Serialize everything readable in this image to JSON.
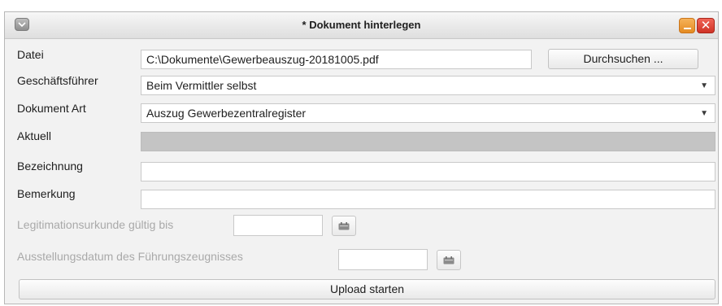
{
  "window": {
    "title": "* Dokument hinterlegen",
    "close_glyph": "✕"
  },
  "form": {
    "datei": {
      "label": "Datei",
      "value": "C:\\Dokumente\\Gewerbeauszug-20181005.pdf",
      "browse_label": "Durchsuchen ..."
    },
    "geschaeftsfuehrer": {
      "label": "Geschäftsführer",
      "value": "Beim Vermittler selbst"
    },
    "dokument_art": {
      "label": "Dokument Art",
      "value": "Auszug Gewerbezentralregister"
    },
    "aktuell": {
      "label": "Aktuell",
      "value": ""
    },
    "bezeichnung": {
      "label": "Bezeichnung",
      "value": ""
    },
    "bemerkung": {
      "label": "Bemerkung",
      "value": ""
    },
    "legitimation": {
      "label": "Legitimationsurkunde gültig bis",
      "value": ""
    },
    "ausstellungsdatum": {
      "label": "Ausstellungsdatum des Führungszeugnisses",
      "value": ""
    },
    "upload_label": "Upload starten"
  },
  "icons": {
    "window_menu": "window-menu-icon",
    "minimize": "minimize-icon",
    "close": "close-icon",
    "select_arrow": "▼",
    "calendar": "calendar-icon"
  },
  "colors": {
    "minimize": "#e48b22",
    "close": "#cf3326",
    "disabled_field": "#c4c4c4"
  }
}
